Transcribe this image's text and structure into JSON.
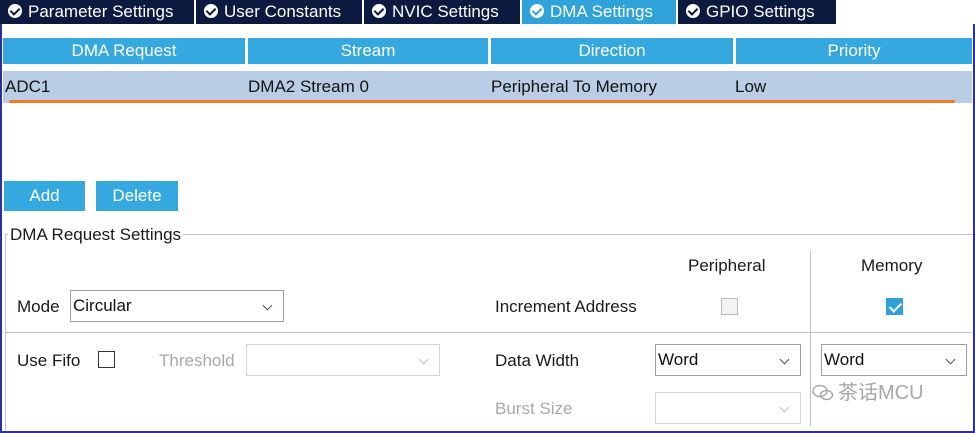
{
  "tabs": [
    {
      "label": "Parameter Settings",
      "active": false
    },
    {
      "label": "User Constants",
      "active": false
    },
    {
      "label": "NVIC Settings",
      "active": false
    },
    {
      "label": "DMA Settings",
      "active": true
    },
    {
      "label": "GPIO Settings",
      "active": false
    }
  ],
  "table": {
    "columns": [
      "DMA Request",
      "Stream",
      "Direction",
      "Priority"
    ],
    "rows": [
      [
        "ADC1",
        "DMA2 Stream 0",
        "Peripheral To Memory",
        "Low"
      ]
    ]
  },
  "buttons": {
    "add": "Add",
    "delete": "Delete"
  },
  "settings": {
    "title": "DMA Request Settings",
    "peripheral_header": "Peripheral",
    "memory_header": "Memory",
    "mode_label": "Mode",
    "mode_value": "Circular",
    "increment_label": "Increment Address",
    "peripheral_increment_checked": false,
    "memory_increment_checked": true,
    "use_fifo_label": "Use Fifo",
    "use_fifo_checked": false,
    "threshold_label": "Threshold",
    "threshold_value": "",
    "data_width_label": "Data Width",
    "peripheral_data_width": "Word",
    "memory_data_width": "Word",
    "burst_size_label": "Burst Size",
    "peripheral_burst_size": ""
  },
  "watermark": {
    "text": "茶话MCU",
    "icon": "wechat-icon"
  },
  "colors": {
    "tab_dark": "#0c1a3f",
    "tab_active": "#2fa3d9",
    "header_blue": "#35a8e0",
    "row_selected": "#b9cee4",
    "highlight_underline": "#f07a26",
    "checkbox_checked": "#2f9fd8"
  }
}
